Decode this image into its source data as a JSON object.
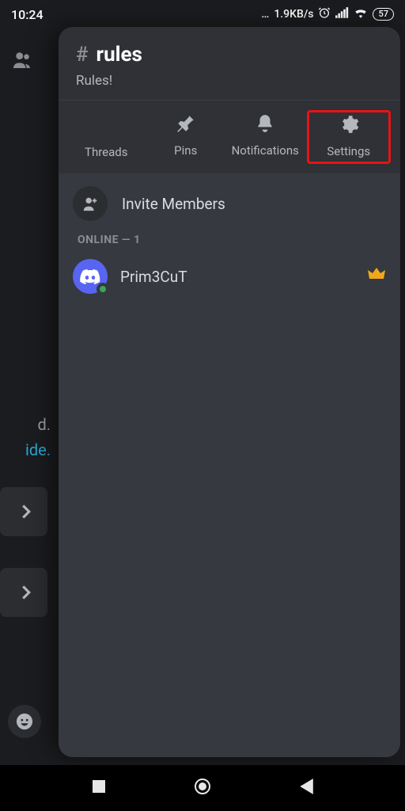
{
  "status": {
    "time": "10:24",
    "net": "1.9KB/s",
    "battery": "57"
  },
  "left": {
    "t1": "d.",
    "t2": "ide."
  },
  "channel": {
    "name": "rules",
    "topic": "Rules!"
  },
  "actions": {
    "threads": "Threads",
    "pins": "Pins",
    "notifications": "Notifications",
    "settings": "Settings"
  },
  "members": {
    "invite": "Invite Members",
    "section": "ONLINE — 1",
    "user1": "Prim3CuT"
  }
}
